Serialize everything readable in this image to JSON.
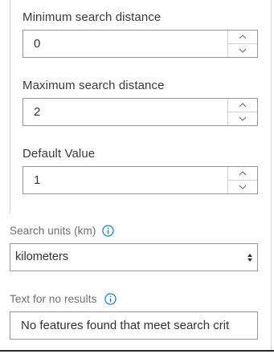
{
  "fields": {
    "min_distance": {
      "label": "Minimum search distance",
      "value": "0"
    },
    "max_distance": {
      "label": "Maximum search distance",
      "value": "2"
    },
    "default_value": {
      "label": "Default Value",
      "value": "1"
    }
  },
  "search_units": {
    "label": "Search units (km)",
    "selected": "kilometers",
    "info_icon": "info-icon"
  },
  "no_results": {
    "label": "Text for no results",
    "value": "No features found that meet search crit",
    "info_icon": "info-icon"
  },
  "colors": {
    "accent": "#007ac2",
    "border": "#959595",
    "text": "#323232"
  }
}
